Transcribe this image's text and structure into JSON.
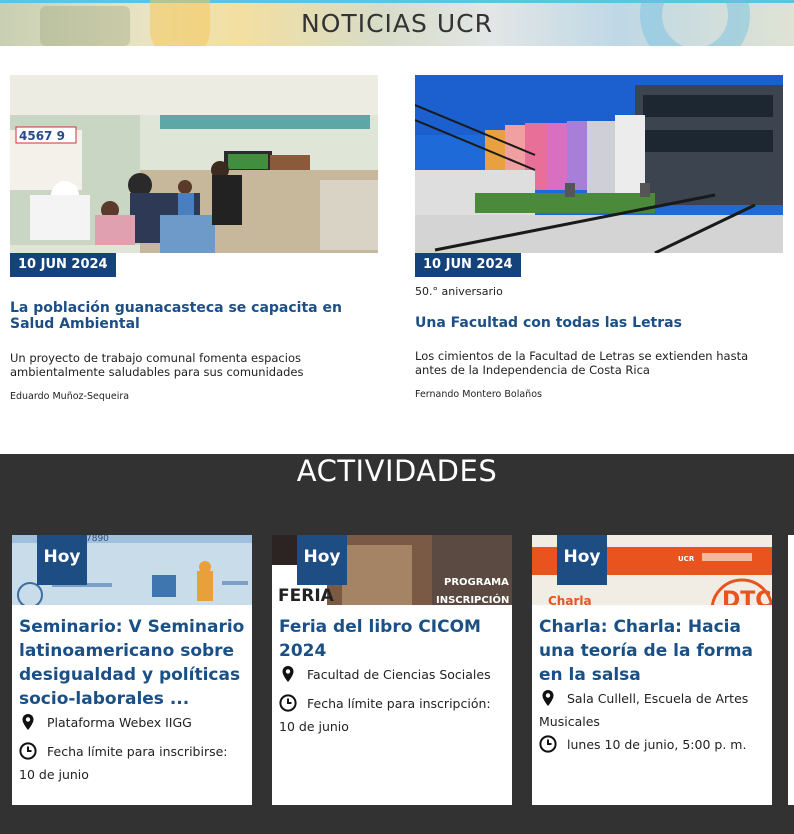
{
  "banner": {
    "title": "NOTICIAS UCR"
  },
  "news": [
    {
      "date": "10 JUN 2024",
      "kicker": "",
      "title": "La población guanacasteca se capacita en Salud Ambiental",
      "subtitle": "Un proyecto de trabajo comunal fomenta espacios ambientalmente saludables para sus comunidades",
      "author": "Eduardo Muñoz-Sequeira"
    },
    {
      "date": "10 JUN 2024",
      "kicker": "50.° aniversario",
      "title": "Una Facultad con todas las Letras",
      "subtitle": "Los cimientos de la Facultad de Letras se extienden hasta antes de la Independencia de Costa Rica",
      "author": "Fernando Montero Bolaños"
    }
  ],
  "activities": {
    "heading": "ACTIVIDADES",
    "items": [
      {
        "badge": "Hoy",
        "title": "Seminario: V Seminario latinoamericano sobre desigualdad y políticas socio-laborales ...",
        "place": "Plataforma Webex IIGG",
        "deadline": "Fecha límite para inscribirse: 10 de junio",
        "image_text": "7890"
      },
      {
        "badge": "Hoy",
        "title": "Feria del libro CICOM 2024",
        "place": "Facultad de Ciencias Sociales",
        "deadline": "Fecha límite para inscripción: 10 de junio",
        "image_text_1": "FERIA",
        "image_text_2": "PROGRAMA",
        "image_text_3": "INSCRIPCIÓN"
      },
      {
        "badge": "Hoy",
        "title": "Charla: Charla: Hacia una teoría de la forma en la salsa",
        "place": "Sala Cullell, Escuela de Artes Musicales",
        "deadline": "lunes 10 de junio, 5:00 p. m.",
        "image_text_1": "Charla",
        "image_text_2": "DTC",
        "image_text_3": "UCR"
      }
    ]
  },
  "colors": {
    "brand_blue": "#14427a",
    "title_blue": "#1d4f86",
    "dark_bg": "#323232"
  },
  "icons": [
    "map-pin-icon",
    "clock-icon"
  ]
}
